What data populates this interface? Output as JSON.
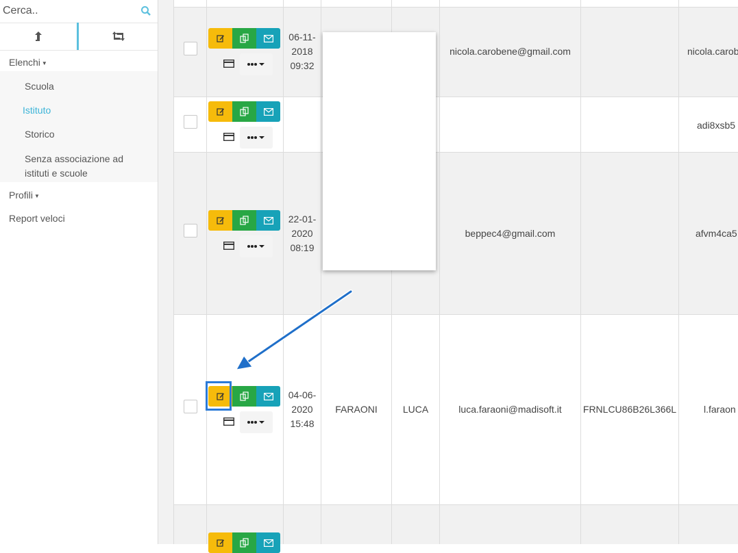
{
  "sidebar": {
    "search_placeholder": "Cerca..",
    "menu": {
      "elenchi": "Elenchi",
      "elenchi_items": [
        "Scuola",
        "Istituto",
        "Storico",
        "Senza associazione ad istituti e scuole"
      ],
      "profili": "Profili",
      "report": "Report veloci"
    },
    "active_item": "Istituto"
  },
  "rows": [
    {
      "date_line1": "06-11-",
      "date_line2": "2018",
      "time": "09:32",
      "cognome": "",
      "nome": "",
      "email": "nicola.carobene@gmail.com",
      "cf": "",
      "username": "nicola.carob"
    },
    {
      "date_line1": "",
      "date_line2": "",
      "time": "",
      "cognome": "",
      "nome": "",
      "email": "",
      "cf": "",
      "username": "adi8xsb5"
    },
    {
      "date_line1": "22-01-",
      "date_line2": "2020",
      "time": "08:19",
      "cognome": "",
      "nome": "",
      "email": "beppec4@gmail.com",
      "cf": "",
      "username": "afvm4ca5"
    },
    {
      "date_line1": "04-06-",
      "date_line2": "2020",
      "time": "15:48",
      "cognome": "FARAONI",
      "nome": "LUCA",
      "email": "luca.faraoni@madisoft.it",
      "cf": "FRNLCU86B26L366L",
      "username": "l.faraon"
    }
  ],
  "colors": {
    "edit": "#f6bb0b",
    "copy": "#28a745",
    "mail": "#17a2b8",
    "accent": "#3bb4d8",
    "highlight": "#2a7ad8"
  }
}
